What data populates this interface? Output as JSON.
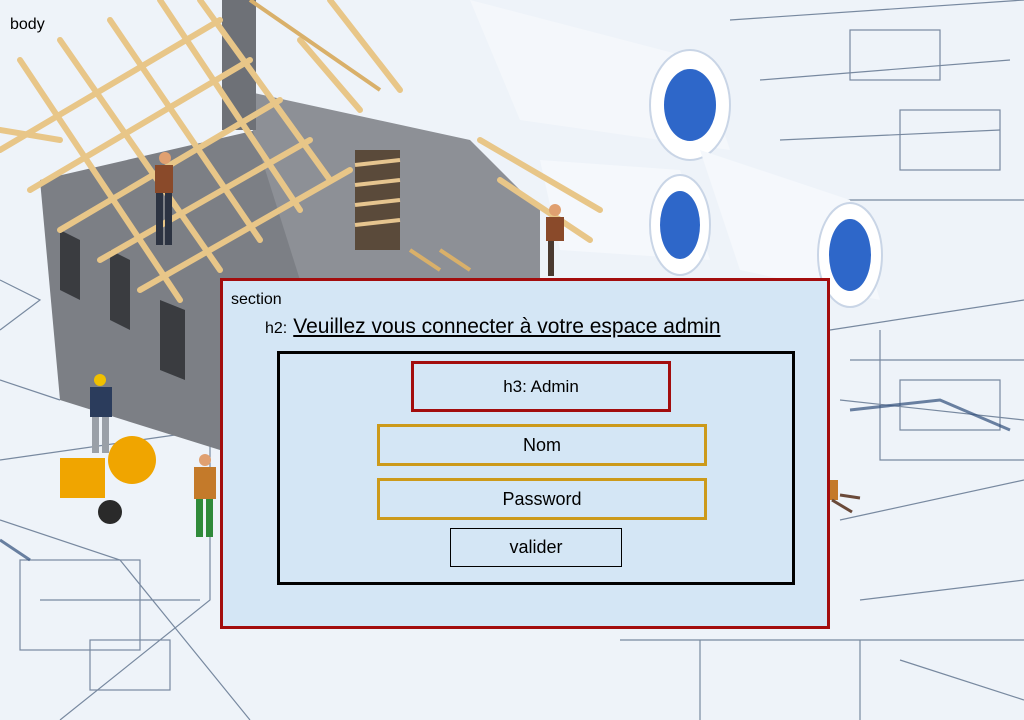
{
  "body_tag": "body",
  "section": {
    "tag": "section",
    "h2_prefix": "h2:",
    "title": "Veuillez vous connecter à votre espace admin",
    "h3_label": "h3: Admin",
    "nom_placeholder": "Nom",
    "password_placeholder": "Password",
    "submit_label": "valider"
  },
  "colors": {
    "section_background": "#d4e6f5",
    "section_border": "#a30d0d",
    "form_border": "#000000",
    "field_border": "#cc9a1a"
  }
}
